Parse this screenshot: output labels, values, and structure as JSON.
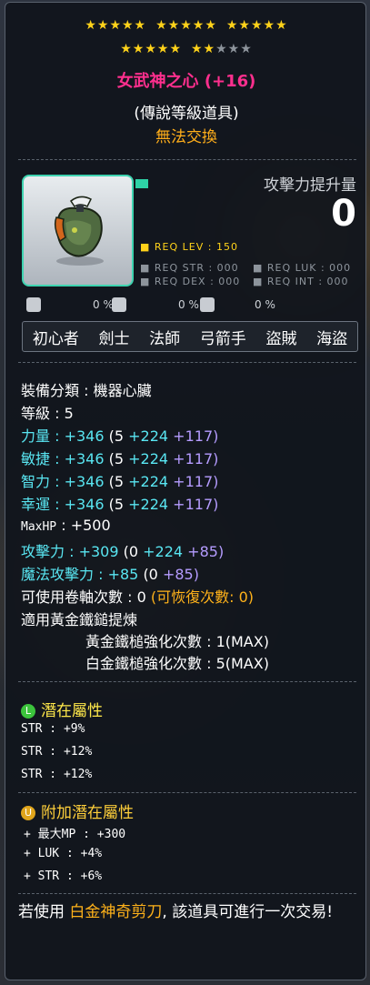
{
  "stars": {
    "filled": 22,
    "total": 25
  },
  "item": {
    "name": "女武神之心 (+16)",
    "grade": "(傳說等級道具)",
    "tradeable": "無法交換",
    "attack_increase_label": "攻擊力提升量",
    "attack_increase_value": "0"
  },
  "requirements": {
    "lev": "■ REQ LEV : 150",
    "str": "■ REQ STR : 000",
    "luk": "■ REQ LUK : 000",
    "dex": "■ REQ DEX : 000",
    "int": "■ REQ INT : 000",
    "pct1": "0 %",
    "pct2": "0 %",
    "pct3": "0 %"
  },
  "jobs": [
    "初心者",
    "劍士",
    "法師",
    "弓箭手",
    "盜賊",
    "海盜"
  ],
  "stats": {
    "category": "裝備分類 : 機器心臟",
    "level": "等級 : 5",
    "str": {
      "label": "力量",
      "total": " : +346",
      "base": "(5 ",
      "bonus": "+224",
      "enh": " +117)"
    },
    "dex": {
      "label": "敏捷",
      "total": " : +346",
      "base": "(5 ",
      "bonus": "+224",
      "enh": " +117)"
    },
    "int": {
      "label": "智力",
      "total": " : +346",
      "base": "(5 ",
      "bonus": "+224",
      "enh": " +117)"
    },
    "luk": {
      "label": "幸運",
      "total": " : +346",
      "base": "(5 ",
      "bonus": "+224",
      "enh": " +117)"
    },
    "maxhp": {
      "label": "MaxHP",
      "value": " : +500"
    },
    "att": {
      "label": "攻擊力",
      "total": " : +309",
      "base": "(0 ",
      "bonus": "+224",
      "enh": " +85)"
    },
    "matt": {
      "label": "魔法攻擊力",
      "total": " : +85",
      "base": "(0 ",
      "enh": "+85)"
    },
    "upgrades": "可使用卷軸次數 : 0",
    "recover": "(可恢復次數: 0)",
    "hammer": "適用黃金鐵鎚提煉",
    "gold_hammer": "黃金鐵槌強化次數 : 1(MAX)",
    "platinum_hammer": "白金鐵槌強化次數 : 5(MAX)"
  },
  "potential": {
    "badge": "L",
    "title": "潛在屬性",
    "lines": [
      "STR : +9%",
      "STR : +12%",
      "STR : +12%"
    ]
  },
  "additional": {
    "badge": "U",
    "title": "附加潛在屬性",
    "lines": [
      "+ 最大MP : +300",
      "+ LUK : +4%",
      "+ STR : +6%"
    ]
  },
  "scissor": {
    "prefix": "若使用 ",
    "item": "白金神奇剪刀",
    "suffix": ", 該道具可進行一次交易!"
  },
  "colors": {
    "title": "#ff2f8e",
    "legendary_border": "#3ed3b0",
    "star": "#ffd21a",
    "stat": "#59e6f2",
    "enhance": "#b59cff",
    "untradeable": "#ffae1a",
    "potential": "#ffe84a",
    "additional": "#ffcf3a"
  }
}
